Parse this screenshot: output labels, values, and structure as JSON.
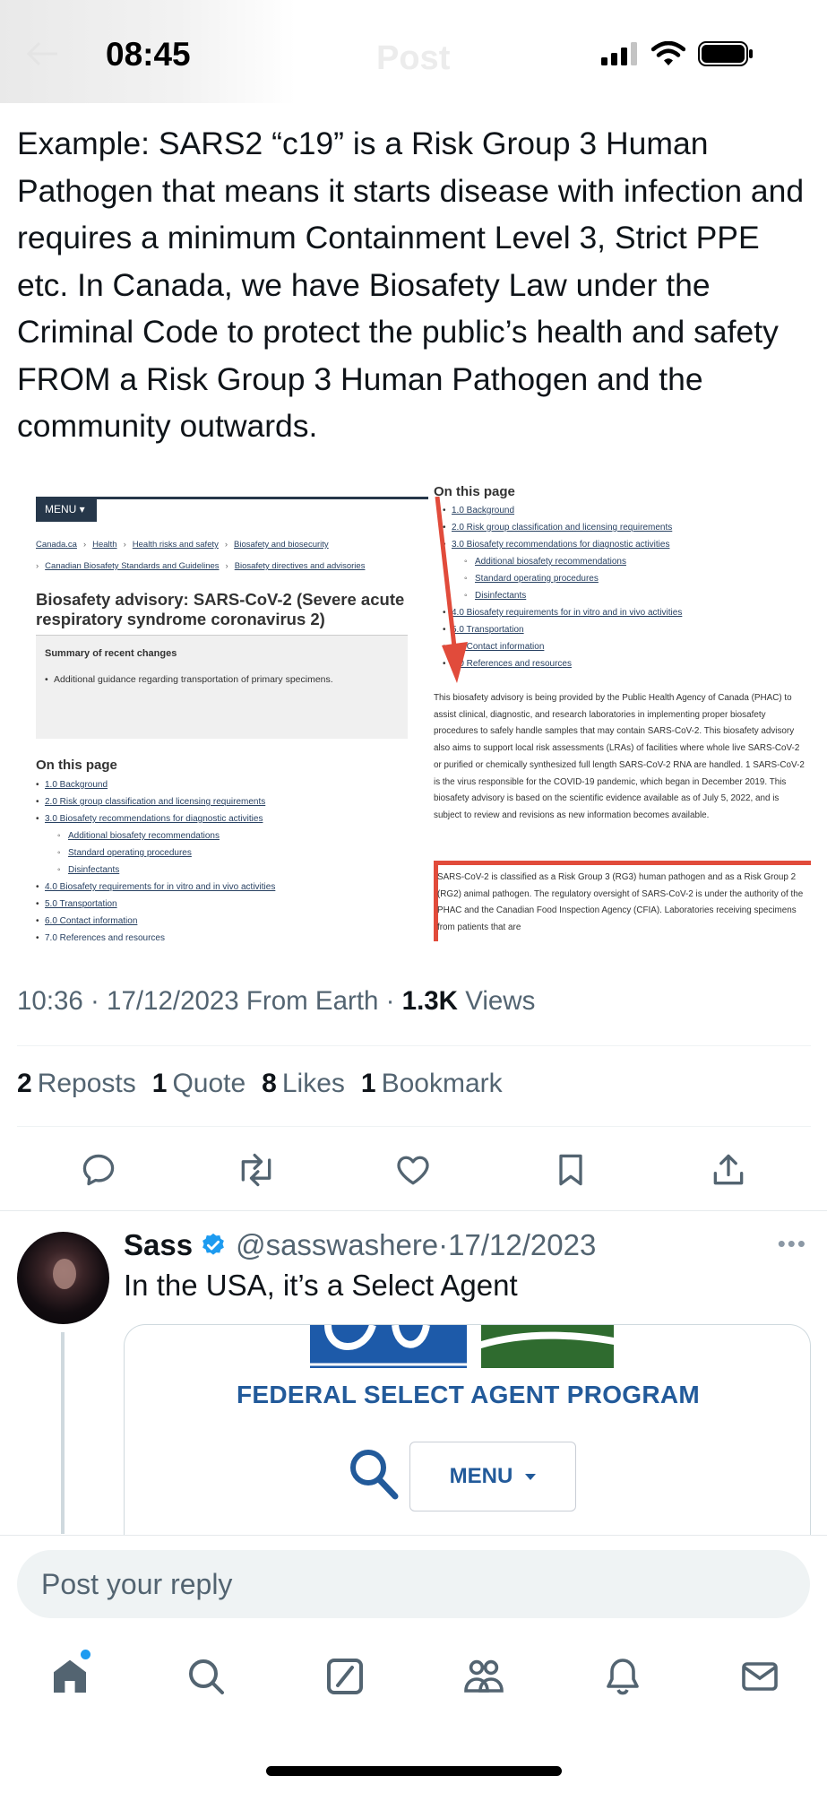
{
  "status_bar": {
    "time": "08:45",
    "ghost_title": "Post"
  },
  "post": {
    "text": "Example: SARS2 “c19” is a Risk Group 3 Human Pathogen that means it starts disease with infection and requires a minimum Containment Level 3, Strict PPE etc. In Canada, we have Biosafety Law under the Criminal Code to protect the public’s health and safety FROM a Risk Group 3 Human Pathogen and the community outwards.",
    "meta": {
      "time": "10:36",
      "date": "17/12/2023",
      "source": "From Earth",
      "views_count": "1.3K",
      "views_label": "Views"
    },
    "stats": [
      {
        "count": "2",
        "label": "Reposts"
      },
      {
        "count": "1",
        "label": "Quote"
      },
      {
        "count": "8",
        "label": "Likes"
      },
      {
        "count": "1",
        "label": "Bookmark"
      }
    ],
    "actions": [
      "reply-icon",
      "repost-icon",
      "like-icon",
      "bookmark-icon",
      "share-icon"
    ]
  },
  "screenshot": {
    "menu": "MENU",
    "breadcrumb": [
      "Canada.ca",
      "Health",
      "Health risks and safety",
      "Biosafety and biosecurity",
      "Canadian Biosafety Standards and Guidelines",
      "Biosafety directives and advisories"
    ],
    "title": "Biosafety advisory: SARS-CoV-2 (Severe acute respiratory syndrome coronavirus 2)",
    "summary_title": "Summary of recent changes",
    "summary_item": "Additional guidance regarding transportation of primary specimens.",
    "on_this_page": "On this page",
    "toc": [
      {
        "text": "1.0 Background",
        "sub": false
      },
      {
        "text": "2.0 Risk group classification and licensing requirements",
        "sub": false
      },
      {
        "text": "3.0 Biosafety recommendations for diagnostic activities",
        "sub": false
      },
      {
        "text": "Additional biosafety recommendations",
        "sub": true
      },
      {
        "text": "Standard operating procedures",
        "sub": true
      },
      {
        "text": "Disinfectants",
        "sub": true
      },
      {
        "text": "4.0 Biosafety requirements for in vitro and in vivo activities",
        "sub": false
      },
      {
        "text": "5.0 Transportation",
        "sub": false
      },
      {
        "text": "6.0 Contact information",
        "sub": false
      },
      {
        "text": "7.0 References and resources",
        "sub": false
      }
    ],
    "right_toc": [
      {
        "text": "1.0 Background",
        "sub": false
      },
      {
        "text": "2.0 Risk group classification and licensing requirements",
        "sub": false
      },
      {
        "text": "3.0 Biosafety recommendations for diagnostic activities",
        "sub": false
      },
      {
        "text": "Additional biosafety recommendations",
        "sub": true
      },
      {
        "text": "Standard operating procedures",
        "sub": true
      },
      {
        "text": "Disinfectants",
        "sub": true
      },
      {
        "text": "4.0 Biosafety requirements for in vitro and in vivo activities",
        "sub": false
      },
      {
        "text": "5.0 Transportation",
        "sub": false
      },
      {
        "text": "6.0 Contact information",
        "sub": false
      },
      {
        "text": "7.0 References and resources",
        "sub": false
      }
    ],
    "paragraph1": "This biosafety advisory is being provided by the Public Health Agency of Canada (PHAC) to assist clinical, diagnostic, and research laboratories in implementing proper biosafety procedures to safely handle samples that may contain SARS-CoV-2. This biosafety advisory also aims to support local risk assessments (LRAs) of facilities where whole live SARS-CoV-2 or purified or chemically synthesized full length SARS-CoV-2 RNA are handled. 1 SARS-CoV-2 is the virus responsible for the COVID-19 pandemic, which began in December 2019. This biosafety advisory is based on the scientific evidence available as of July 5, 2022, and is subject to review and revisions as new information becomes available.",
    "paragraph2": "SARS-CoV-2 is classified as a Risk Group 3 (RG3) human pathogen and as a Risk Group 2 (RG2) animal pathogen. The regulatory oversight of SARS-CoV-2 is under the authority of the PHAC and the Canadian Food Inspection Agency (CFIA). Laboratories receiving specimens from patients that are"
  },
  "reply": {
    "name": "Sass",
    "handle": "@sasswashere",
    "date": "17/12/2023",
    "text": "In the USA, it’s a Select Agent",
    "card": {
      "title": "FEDERAL SELECT AGENT PROGRAM",
      "menu": "MENU"
    }
  },
  "composer": {
    "placeholder": "Post your reply"
  },
  "tabbar": [
    "home-icon",
    "search-icon",
    "grok-icon",
    "communities-icon",
    "notifications-icon",
    "messages-icon"
  ],
  "colors": {
    "accent": "#1d9bf0",
    "text": "#0f1419",
    "muted": "#536471",
    "highlight_red": "#e14b3b"
  }
}
